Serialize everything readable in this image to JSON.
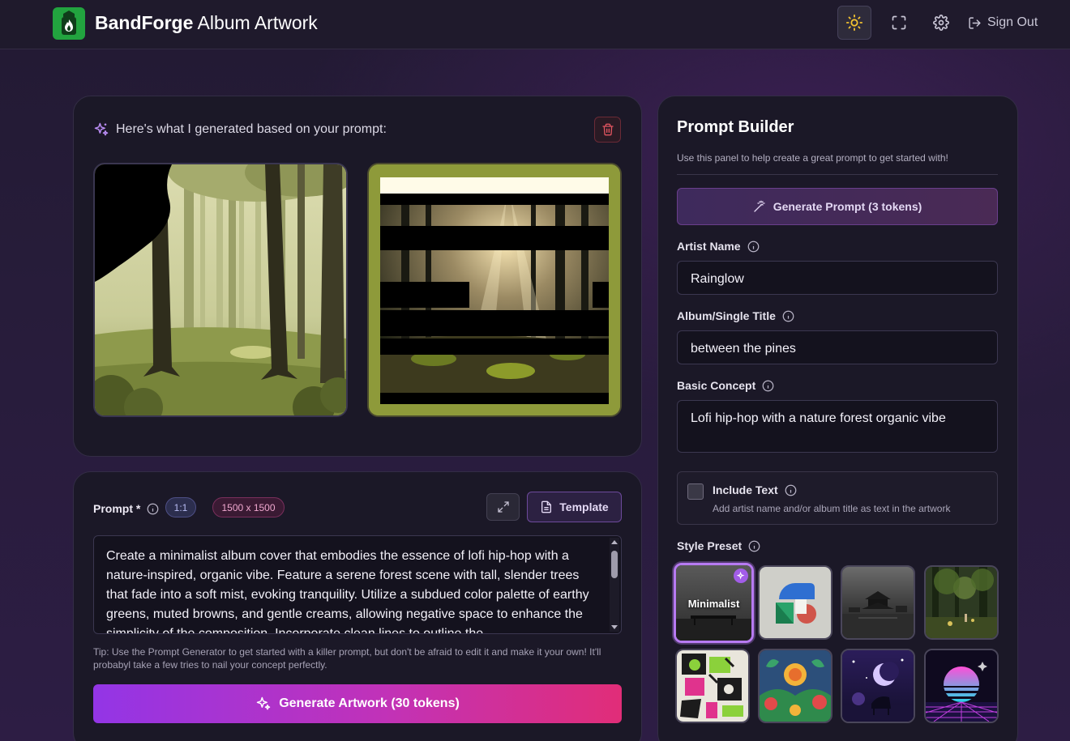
{
  "header": {
    "brand_bold": "BandForge",
    "brand_rest": "Album Artwork",
    "sign_out": "Sign Out"
  },
  "generated": {
    "title": "Here's what I generated based on your prompt:"
  },
  "prompt": {
    "label": "Prompt *",
    "aspect_ratio": "1:1",
    "resolution": "1500 x 1500",
    "template_label": "Template",
    "text": "Create a minimalist album cover that embodies the essence of lofi hip-hop with a nature-inspired, organic vibe. Feature a serene forest scene with tall, slender trees that fade into a soft mist, evoking tranquility. Utilize a subdued color palette of earthy greens, muted browns, and gentle creams, allowing negative space to enhance the simplicity of the composition. Incorporate clean lines to outline the",
    "tip": "Tip: Use the Prompt Generator to get started with a killer prompt, but don't be afraid to edit it and make it your own! It'll probabyl take a few tries to nail your concept perfectly.",
    "generate_label": "Generate Artwork (30 tokens)"
  },
  "builder": {
    "title": "Prompt Builder",
    "subtitle": "Use this panel to help create a great prompt to get started with!",
    "generate_prompt_label": "Generate Prompt (3 tokens)",
    "artist_label": "Artist Name",
    "artist_value": "Rainglow",
    "album_label": "Album/Single Title",
    "album_value": "between the pines",
    "concept_label": "Basic Concept",
    "concept_value": "Lofi hip-hop with a nature forest organic vibe",
    "include_text_label": "Include Text",
    "include_text_desc": "Add artist name and/or album title as text in the artwork",
    "include_text_checked": false,
    "style_preset_label": "Style Preset",
    "selected_preset_label": "Minimalist"
  },
  "colors": {
    "accent_purple": "#9335e6",
    "accent_pink": "#e12d78",
    "logo_green": "#22a33f",
    "sun_yellow": "#f2c230"
  }
}
